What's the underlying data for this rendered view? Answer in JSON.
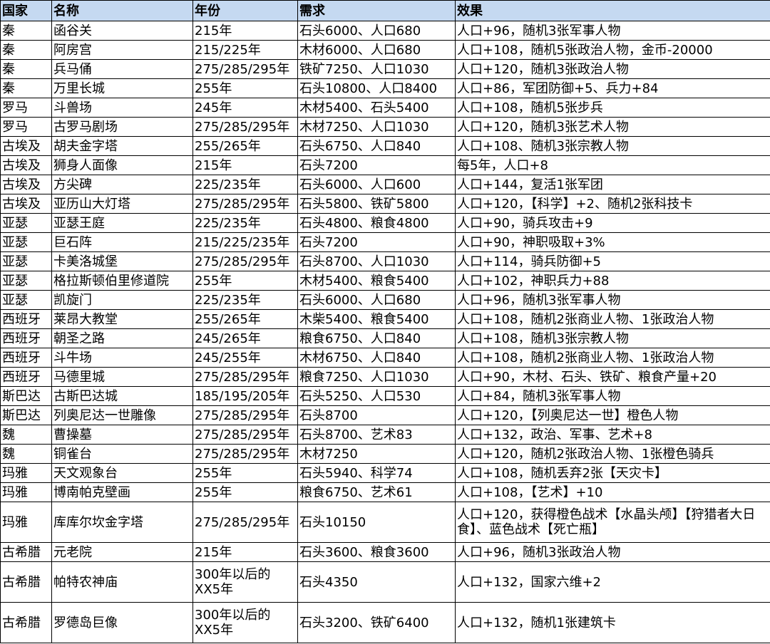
{
  "headers": [
    "国家",
    "名称",
    "年份",
    "需求",
    "效果"
  ],
  "rows": [
    {
      "country": "秦",
      "name": "函谷关",
      "year": "215年",
      "need": "石头6000、人口680",
      "effect": "人口+96，随机3张军事人物"
    },
    {
      "country": "秦",
      "name": "阿房宫",
      "year": "215/225年",
      "need": "木材6000、人口680",
      "effect": "人口+108，随机5张政治人物，金币-20000"
    },
    {
      "country": "秦",
      "name": "兵马俑",
      "year": "275/285/295年",
      "need": "铁矿7250、人口1030",
      "effect": "人口+120，随机3张政治人物"
    },
    {
      "country": "秦",
      "name": "万里长城",
      "year": "255年",
      "need": "石头10800、人口8400",
      "effect": "人口+86，军团防御+5、兵力+84"
    },
    {
      "country": "罗马",
      "name": "斗兽场",
      "year": "245年",
      "need": "木材5400、石头5400",
      "effect": "人口+108，随机5张步兵"
    },
    {
      "country": "罗马",
      "name": "古罗马剧场",
      "year": "275/285/295年",
      "need": "木材7250、人口1030",
      "effect": "人口+120，随机3张艺术人物"
    },
    {
      "country": "古埃及",
      "name": "胡夫金字塔",
      "year": "255/265年",
      "need": "石头6750、人口840",
      "effect": "人口+108、随机3张宗教人物"
    },
    {
      "country": "古埃及",
      "name": "狮身人面像",
      "year": "215年",
      "need": "石头7200",
      "effect": "每5年，人口+8"
    },
    {
      "country": "古埃及",
      "name": "方尖碑",
      "year": "225/235年",
      "need": "石头6000、人口600",
      "effect": "人口+144，复活1张军团"
    },
    {
      "country": "古埃及",
      "name": "亚历山大灯塔",
      "year": "275/285/295年",
      "need": "石头5800、铁矿5800",
      "effect": "人口+120，【科学】+2、随机2张科技卡"
    },
    {
      "country": "亚瑟",
      "name": "亚瑟王庭",
      "year": "225/235年",
      "need": "石头4800、粮食4800",
      "effect": "人口+90，骑兵攻击+9"
    },
    {
      "country": "亚瑟",
      "name": "巨石阵",
      "year": "215/225/235年",
      "need": "石头7200",
      "effect": "人口+90，神职吸取+3%"
    },
    {
      "country": "亚瑟",
      "name": "卡美洛城堡",
      "year": "275/285/295年",
      "need": "石头8700、人口1030",
      "effect": "人口+114，骑兵防御+5"
    },
    {
      "country": "亚瑟",
      "name": "格拉斯顿伯里修道院",
      "year": "255年",
      "need": "木材5400、粮食5400",
      "effect": "人口+102，神职兵力+88"
    },
    {
      "country": "亚瑟",
      "name": "凯旋门",
      "year": "225/235年",
      "need": "石头6000、人口680",
      "effect": "人口+96，随机3张军事人物"
    },
    {
      "country": "西班牙",
      "name": "莱昂大教堂",
      "year": "255/265年",
      "need": "木柴5400、粮食5400",
      "effect": "人口+108，随机2张商业人物、1张政治人物"
    },
    {
      "country": "西班牙",
      "name": "朝圣之路",
      "year": "245/265年",
      "need": "粮食6750、人口840",
      "effect": "人口+108，随机3张宗教人物"
    },
    {
      "country": "西班牙",
      "name": "斗牛场",
      "year": "245/255年",
      "need": "木材6750、人口840",
      "effect": "人口+108，随机2张商业人物、1张政治人物"
    },
    {
      "country": "西班牙",
      "name": "马德里城",
      "year": "275/285/295年",
      "need": "粮食7250、人口1030",
      "effect": "人口+90，木材、石头、铁矿、粮食产量+20"
    },
    {
      "country": "斯巴达",
      "name": "古斯巴达城",
      "year": "185/195/205年",
      "need": "石头5250、人口530",
      "effect": "人口+84，随机3张军事人物"
    },
    {
      "country": "斯巴达",
      "name": "列奥尼达一世雕像",
      "year": "275/285/295年",
      "need": "石头8700",
      "effect": "人口+120，【列奥尼达一世】橙色人物"
    },
    {
      "country": "魏",
      "name": "曹操墓",
      "year": "275/285/295年",
      "need": "石头8700、艺术83",
      "effect": "人口+132，政治、军事、艺术+8"
    },
    {
      "country": "魏",
      "name": "铜雀台",
      "year": "275/285/295年",
      "need": "木材7250",
      "effect": "人口+120，随机2张政治人物、1张橙色骑兵"
    },
    {
      "country": "玛雅",
      "name": "天文观象台",
      "year": "255年",
      "need": "石头5940、科学74",
      "effect": "人口+108，随机丢弃2张【天灾卡】"
    },
    {
      "country": "玛雅",
      "name": "博南帕克壁画",
      "year": "255年",
      "need": "粮食6750、艺术61",
      "effect": "人口+108，【艺术】+10"
    },
    {
      "country": "玛雅",
      "name": "库库尔坎金字塔",
      "year": "275/285/295年",
      "need": "石头10150",
      "effect": "人口+120，获得橙色战术【水晶头颅】【狩猎者大日食】、蓝色战术【死亡瓶】"
    },
    {
      "country": "古希腊",
      "name": "元老院",
      "year": "215年",
      "need": "石头3600、粮食3600",
      "effect": "人口+96，随机3张政治人物"
    },
    {
      "country": "古希腊",
      "name": "帕特农神庙",
      "year": "300年以后的XX5年",
      "need": "石头4350",
      "effect": "人口+132，国家六维+2"
    },
    {
      "country": "古希腊",
      "name": "罗德岛巨像",
      "year": "300年以后的XX5年",
      "need": "石头3200、铁矿6400",
      "effect": "人口+132，随机1张建筑卡"
    }
  ]
}
